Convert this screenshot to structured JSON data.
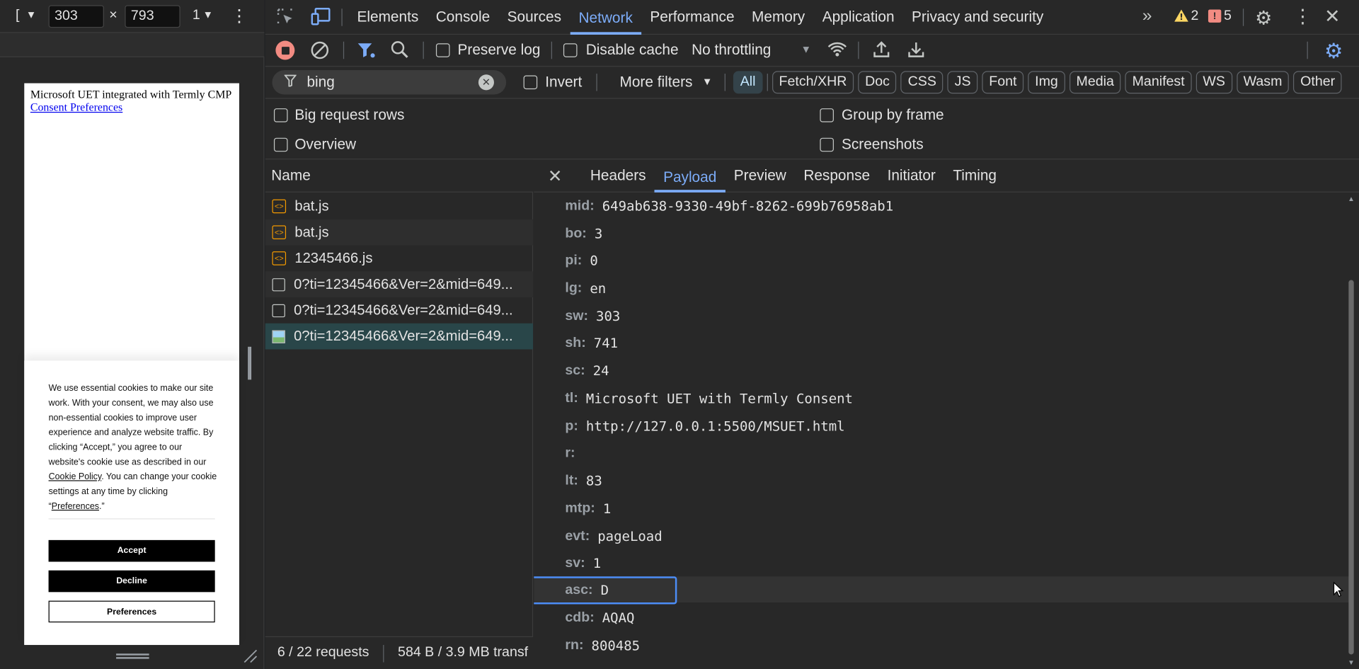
{
  "device": {
    "width": "303",
    "height": "793",
    "dpr_label": "1",
    "mode_label": "[",
    "times": "×"
  },
  "page": {
    "title_text": "Microsoft UET integrated with Termly CMP",
    "link_text": "Consent Preferences",
    "banner": {
      "text_1": "We use essential cookies to make our site work. With your consent, we may also use non-essential cookies to improve user experience and analyze website traffic. By clicking “Accept,” you agree to our website's cookie use as described in our ",
      "cookie_policy": "Cookie Policy",
      "text_2": ". You can change your cookie settings at any time by clicking “",
      "preferences_link": "Preferences",
      "text_3": ".”",
      "accept": "Accept",
      "decline": "Decline",
      "preferences": "Preferences"
    }
  },
  "devtools": {
    "tabs": [
      "Elements",
      "Console",
      "Sources",
      "Network",
      "Performance",
      "Memory",
      "Application",
      "Privacy and security"
    ],
    "active_tab": "Network",
    "warnings": "2",
    "errors": "5",
    "toolbar": {
      "preserve_log": "Preserve log",
      "disable_cache": "Disable cache",
      "throttling": "No throttling"
    },
    "filter": {
      "value": "bing",
      "invert": "Invert",
      "more_filters": "More filters",
      "types": [
        "All",
        "Fetch/XHR",
        "Doc",
        "CSS",
        "JS",
        "Font",
        "Img",
        "Media",
        "Manifest",
        "WS",
        "Wasm",
        "Other"
      ],
      "active_type": "All"
    },
    "options": {
      "big_rows": "Big request rows",
      "group_by_frame": "Group by frame",
      "overview": "Overview",
      "screenshots": "Screenshots"
    },
    "requests": {
      "header": "Name",
      "items": [
        {
          "name": "bat.js",
          "icon": "script-icon"
        },
        {
          "name": "bat.js",
          "icon": "script-icon"
        },
        {
          "name": "12345466.js",
          "icon": "script-icon"
        },
        {
          "name": "0?ti=12345466&Ver=2&mid=649...",
          "icon": "document-icon"
        },
        {
          "name": "0?ti=12345466&Ver=2&mid=649...",
          "icon": "document-icon"
        },
        {
          "name": "0?ti=12345466&Ver=2&mid=649...",
          "icon": "image-icon"
        }
      ],
      "selected_index": 5,
      "status": "6 / 22 requests",
      "transferred": "584 B / 3.9 MB transf"
    },
    "detail": {
      "tabs": [
        "Headers",
        "Payload",
        "Preview",
        "Response",
        "Initiator",
        "Timing"
      ],
      "active_tab": "Payload",
      "params": [
        {
          "k": "mid:",
          "v": "649ab638-9330-49bf-8262-699b76958ab1"
        },
        {
          "k": "bo:",
          "v": "3"
        },
        {
          "k": "pi:",
          "v": "0"
        },
        {
          "k": "lg:",
          "v": "en"
        },
        {
          "k": "sw:",
          "v": "303"
        },
        {
          "k": "sh:",
          "v": "741"
        },
        {
          "k": "sc:",
          "v": "24"
        },
        {
          "k": "tl:",
          "v": "Microsoft UET with Termly Consent"
        },
        {
          "k": "p:",
          "v": "http://127.0.0.1:5500/MSUET.html"
        },
        {
          "k": "r:",
          "v": ""
        },
        {
          "k": "lt:",
          "v": "83"
        },
        {
          "k": "mtp:",
          "v": "1"
        },
        {
          "k": "evt:",
          "v": "pageLoad"
        },
        {
          "k": "sv:",
          "v": "1"
        },
        {
          "k": "asc:",
          "v": "D"
        },
        {
          "k": "cdb:",
          "v": "AQAQ"
        },
        {
          "k": "rn:",
          "v": "800485"
        }
      ],
      "highlighted_index": 14
    }
  },
  "colors": {
    "accent": "#7cacf8",
    "record": "#f28b82",
    "warning": "#fdd663",
    "error": "#f28b82"
  }
}
